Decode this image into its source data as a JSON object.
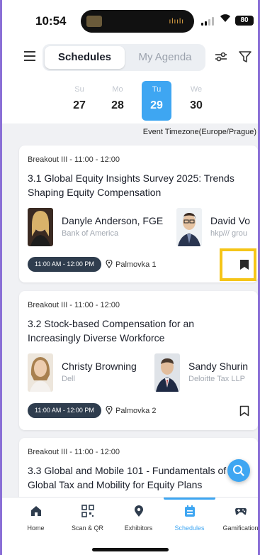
{
  "status_bar": {
    "time": "10:54",
    "battery": "80"
  },
  "header": {
    "tabs": [
      "Schedules",
      "My Agenda"
    ],
    "active_tab": "Schedules"
  },
  "dates": [
    {
      "dow": "Su",
      "num": "27",
      "selected": false
    },
    {
      "dow": "Mo",
      "num": "28",
      "selected": false
    },
    {
      "dow": "Tu",
      "num": "29",
      "selected": true
    },
    {
      "dow": "We",
      "num": "30",
      "selected": false
    }
  ],
  "timezone": "Event Timezone(Europe/Prague)",
  "sessions": [
    {
      "meta": "Breakout III - 11:00 - 12:00",
      "title": "3.1 Global Equity Insights Survey 2025: Trends Shaping Equity Compensation",
      "speakers": [
        {
          "name": "Danyle Anderson, FGE",
          "org": "Bank of America"
        },
        {
          "name": "David Vo",
          "org": "hkp/// grou"
        }
      ],
      "time": "11:00 AM - 12:00 PM",
      "location": "Palmovka 1",
      "bookmarked": true
    },
    {
      "meta": "Breakout III - 11:00 - 12:00",
      "title": "3.2 Stock-based Compensation for an Increasingly Diverse Workforce",
      "speakers": [
        {
          "name": "Christy Browning",
          "org": "Dell"
        },
        {
          "name": "Sandy Shurin",
          "org": "Deloitte Tax LLP"
        }
      ],
      "time": "11:00 AM - 12:00 PM",
      "location": "Palmovka 2",
      "bookmarked": false
    },
    {
      "meta": "Breakout III - 11:00 - 12:00",
      "title": "3.3 Global and Mobile 101 - Fundamentals of Global Tax and Mobility for Equity Plans"
    }
  ],
  "tabbar": [
    {
      "label": "Home",
      "icon": "home-icon"
    },
    {
      "label": "Scan & QR",
      "icon": "qr-icon"
    },
    {
      "label": "Exhibitors",
      "icon": "pin-icon"
    },
    {
      "label": "Schedules",
      "icon": "calendar-icon",
      "active": true
    },
    {
      "label": "Gamification",
      "icon": "gamepad-icon"
    }
  ],
  "colors": {
    "accent": "#3ea6f2",
    "pill": "#2f3d4e",
    "highlight": "#f5c518"
  }
}
